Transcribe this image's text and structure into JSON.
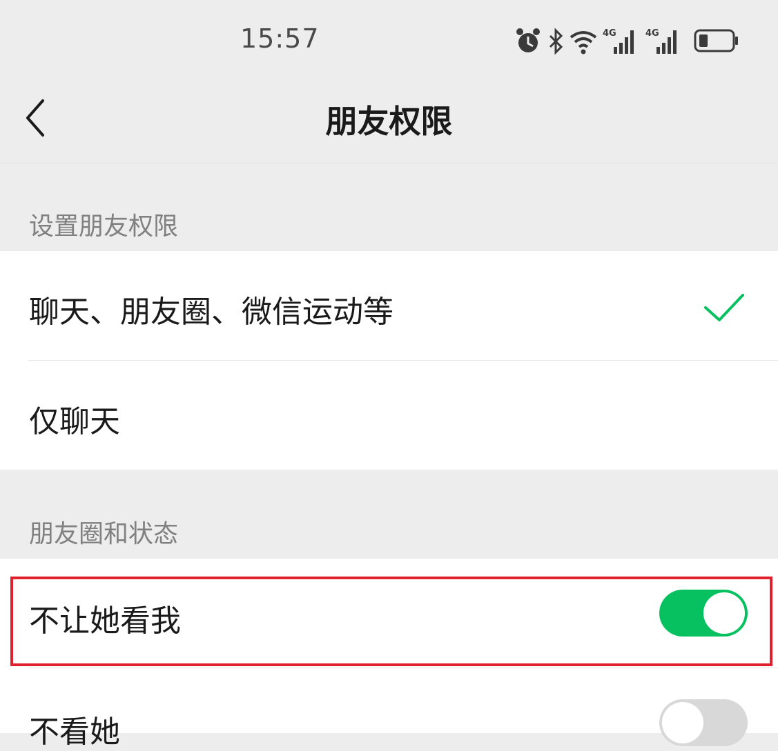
{
  "status_bar": {
    "time": "15:57",
    "icons": [
      "alarm-icon",
      "bluetooth-icon",
      "wifi-icon",
      "signal-4g-icon",
      "signal-4g-icon",
      "battery-icon"
    ],
    "network_label_1": "4G",
    "network_label_2": "4G"
  },
  "nav": {
    "title": "朋友权限",
    "back_icon": "chevron-left-icon"
  },
  "sections": {
    "permissions": {
      "header": "设置朋友权限",
      "options": [
        {
          "label": "聊天、朋友圈、微信运动等",
          "selected": true
        },
        {
          "label": "仅聊天",
          "selected": false
        }
      ]
    },
    "moments": {
      "header": "朋友圈和状态",
      "items": [
        {
          "label": "不让她看我",
          "enabled": true
        },
        {
          "label": "不看她",
          "enabled": false
        }
      ]
    }
  },
  "colors": {
    "accent": "#07c160",
    "highlight": "#e0202c",
    "background": "#ededed"
  }
}
